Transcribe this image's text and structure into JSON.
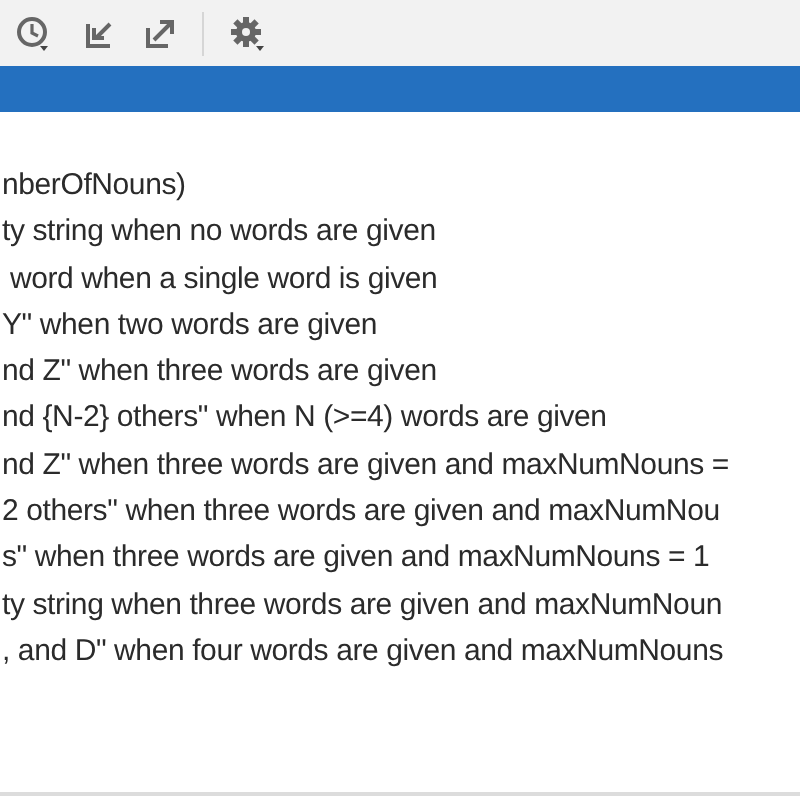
{
  "output": {
    "lines": [
      "nberOfNouns)",
      "ty string when no words are given",
      " word when a single word is given",
      "Y\" when two words are given",
      "nd Z\" when three words are given",
      "nd {N-2} others\" when N (>=4) words are given",
      "nd Z\" when three words are given and maxNumNouns =",
      "2 others\" when three words are given and maxNumNou",
      "s\" when three words are given and maxNumNouns = 1",
      "ty string when three words are given and maxNumNoun",
      ", and D\" when four words are given and maxNumNouns"
    ]
  }
}
